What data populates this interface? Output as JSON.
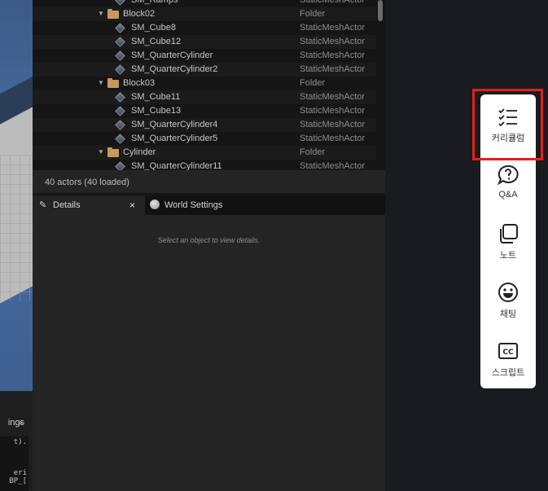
{
  "outliner": {
    "rows": [
      {
        "name": "SM_Ramps",
        "type": "StaticMeshActor",
        "kind": "mesh"
      },
      {
        "name": "Block02",
        "type": "Folder",
        "kind": "folder"
      },
      {
        "name": "SM_Cube8",
        "type": "StaticMeshActor",
        "kind": "mesh"
      },
      {
        "name": "SM_Cube12",
        "type": "StaticMeshActor",
        "kind": "mesh"
      },
      {
        "name": "SM_QuarterCylinder",
        "type": "StaticMeshActor",
        "kind": "mesh"
      },
      {
        "name": "SM_QuarterCylinder2",
        "type": "StaticMeshActor",
        "kind": "mesh"
      },
      {
        "name": "Block03",
        "type": "Folder",
        "kind": "folder"
      },
      {
        "name": "SM_Cube11",
        "type": "StaticMeshActor",
        "kind": "mesh"
      },
      {
        "name": "SM_Cube13",
        "type": "StaticMeshActor",
        "kind": "mesh"
      },
      {
        "name": "SM_QuarterCylinder4",
        "type": "StaticMeshActor",
        "kind": "mesh"
      },
      {
        "name": "SM_QuarterCylinder5",
        "type": "StaticMeshActor",
        "kind": "mesh"
      },
      {
        "name": "Cylinder",
        "type": "Folder",
        "kind": "folder"
      },
      {
        "name": "SM_QuarterCylinder11",
        "type": "StaticMeshActor",
        "kind": "mesh"
      }
    ],
    "status": "40 actors (40 loaded)"
  },
  "tabs": {
    "details": "Details",
    "world_settings": "World Settings",
    "close_glyph": "×"
  },
  "details": {
    "hint": "Select an object to view details."
  },
  "console": {
    "settings_label": "ings",
    "code_lines": [
      "t).",
      "eri",
      "BP_["
    ]
  },
  "sidenav": {
    "items": [
      {
        "label": "커리큘럼",
        "icon": "checklist-icon"
      },
      {
        "label": "Q&A",
        "icon": "question-bubble-icon"
      },
      {
        "label": "노트",
        "icon": "notes-icon"
      },
      {
        "label": "채팅",
        "icon": "smile-icon"
      },
      {
        "label": "스크립트",
        "icon": "cc-icon"
      }
    ]
  },
  "colors": {
    "highlight": "#e0201f",
    "folder": "#c69a5c"
  }
}
